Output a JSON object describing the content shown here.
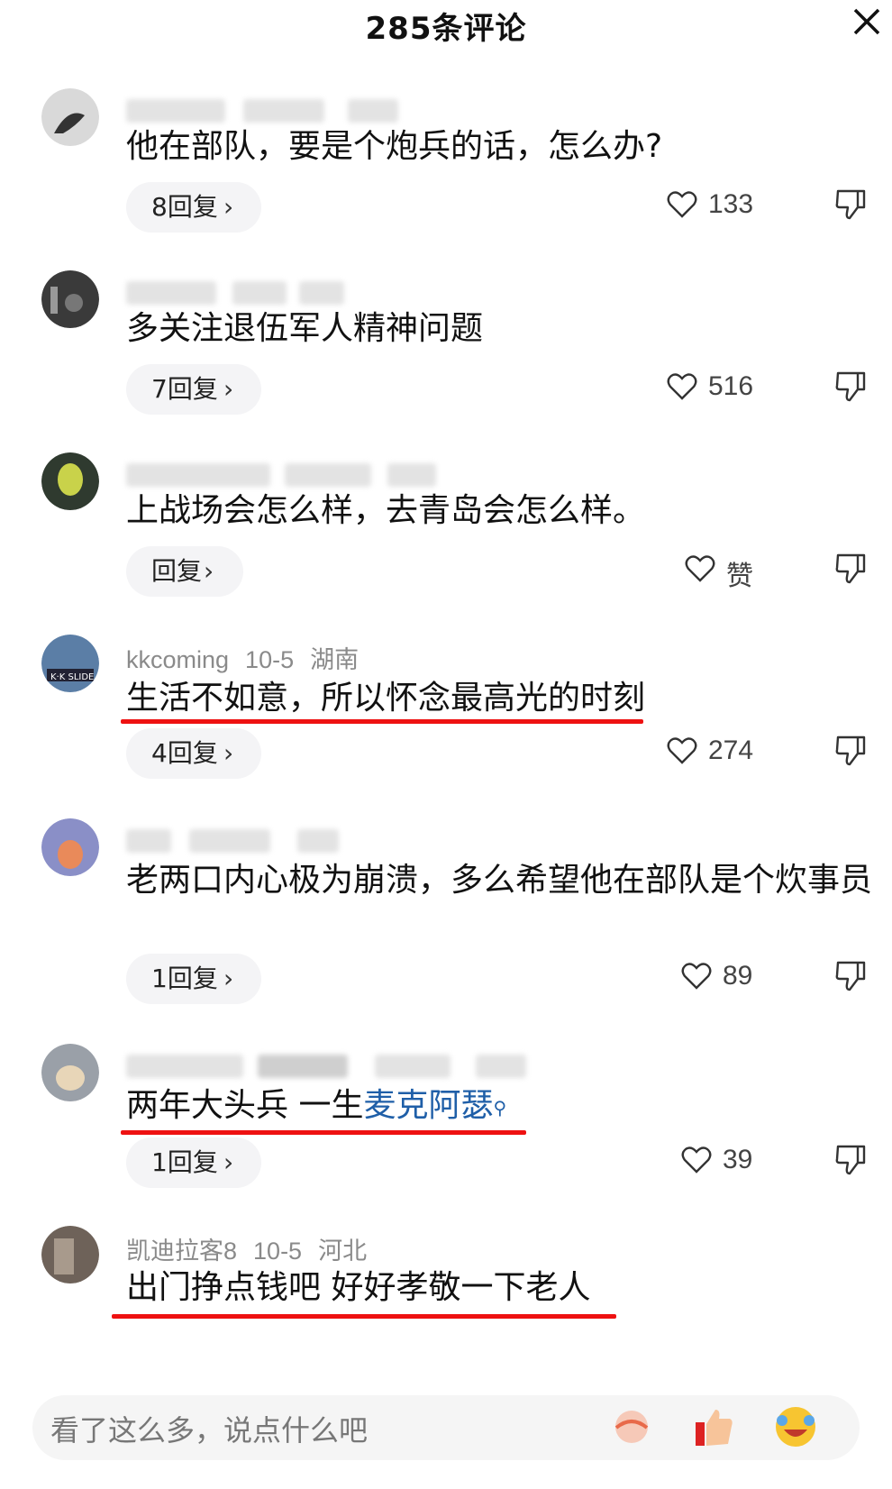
{
  "header": {
    "title": "285条评论",
    "close_icon": "close-icon"
  },
  "comments": [
    {
      "username_hidden": true,
      "text": "他在部队，要是个炮兵的话，怎么办?",
      "replies": "8回复",
      "likes": "133"
    },
    {
      "username_hidden": true,
      "text": "多关注退伍军人精神问题",
      "replies": "7回复",
      "likes": "516"
    },
    {
      "username_hidden": true,
      "text": "上战场会怎么样，去青岛会怎么样。",
      "replies": "回复",
      "likes": "赞"
    },
    {
      "user": "kkcoming",
      "date": "10-5",
      "region": "湖南",
      "text": "生活不如意，所以怀念最高光的时刻",
      "replies": "4回复",
      "likes": "274",
      "underlined": true
    },
    {
      "username_hidden": true,
      "text": "老两口内心极为崩溃，多么希望他在部队是个炊事员",
      "replies": "1回复",
      "likes": "89"
    },
    {
      "username_hidden": true,
      "text_plain": "两年大头兵 一生",
      "text_link": "麦克阿瑟",
      "replies": "1回复",
      "likes": "39",
      "underlined": true
    },
    {
      "user": "凯迪拉客8",
      "date": "10-5",
      "region": "河北",
      "text": "出门挣点钱吧 好好孝敬一下老人",
      "underlined": true
    }
  ],
  "input": {
    "placeholder": "看了这么多，说点什么吧"
  },
  "colors": {
    "underline": "#ee1111",
    "link": "#1f5fa8"
  }
}
